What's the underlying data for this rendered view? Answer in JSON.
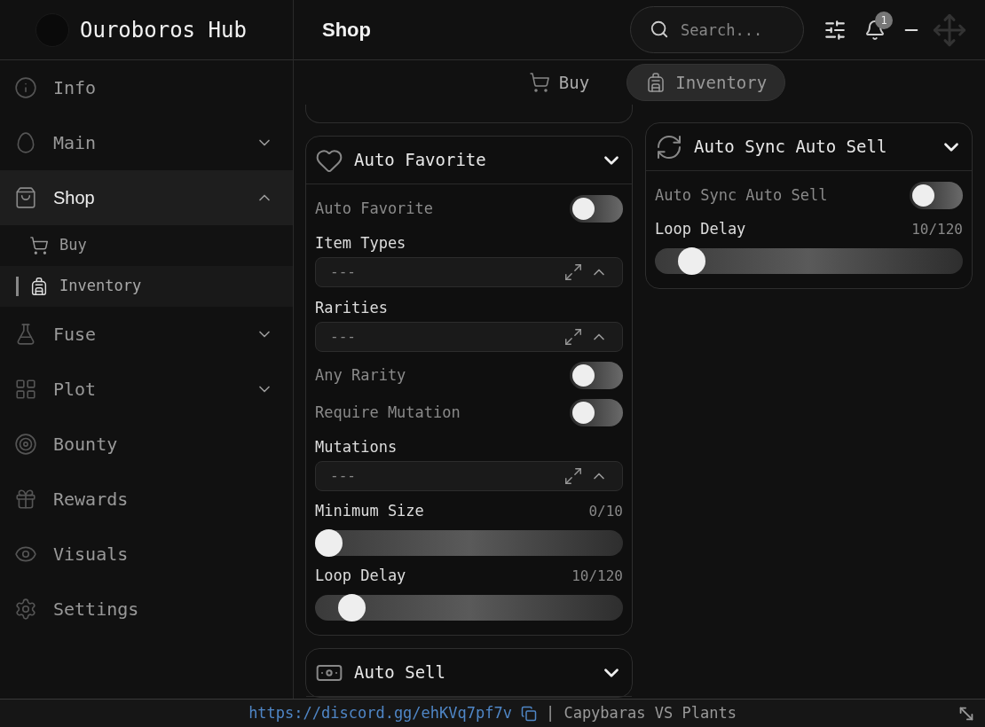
{
  "window": {
    "title": "Ouroboros Hub"
  },
  "sidebar": {
    "items": [
      {
        "label": "Info",
        "kind": "page",
        "selected": false
      },
      {
        "label": "Main",
        "kind": "group",
        "expanded": false,
        "selected": false
      },
      {
        "label": "Shop",
        "kind": "group",
        "expanded": true,
        "selected": true,
        "children": [
          {
            "label": "Buy",
            "selected": false
          },
          {
            "label": "Inventory",
            "selected": true
          }
        ]
      },
      {
        "label": "Fuse",
        "kind": "group",
        "expanded": false,
        "selected": false
      },
      {
        "label": "Plot",
        "kind": "group",
        "expanded": false,
        "selected": false
      },
      {
        "label": "Bounty",
        "kind": "page",
        "selected": false
      },
      {
        "label": "Rewards",
        "kind": "page",
        "selected": false
      },
      {
        "label": "Visuals",
        "kind": "page",
        "selected": false
      },
      {
        "label": "Settings",
        "kind": "page",
        "selected": false
      }
    ]
  },
  "header": {
    "title": "Shop",
    "search": {
      "placeholder": "Search..."
    },
    "notification_count": "1"
  },
  "tabs": [
    {
      "label": "Buy",
      "selected": false
    },
    {
      "label": "Inventory",
      "selected": true
    }
  ],
  "columns": [
    [
      {
        "title": "Auto Favorite",
        "items": [
          {
            "kind": "toggle",
            "label": "Auto Favorite",
            "on": false
          },
          {
            "kind": "dropdown",
            "label": "Item Types",
            "value": "---"
          },
          {
            "kind": "dropdown",
            "label": "Rarities",
            "value": "---"
          },
          {
            "kind": "toggle",
            "label": "Any Rarity",
            "on": false
          },
          {
            "kind": "toggle",
            "label": "Require Mutation",
            "on": false
          },
          {
            "kind": "dropdown",
            "label": "Mutations",
            "value": "---"
          },
          {
            "kind": "slider",
            "label": "Minimum Size",
            "reading": "0/10",
            "level": 0
          },
          {
            "kind": "slider",
            "label": "Loop Delay",
            "reading": "10/120",
            "level": 0.083
          }
        ]
      },
      {
        "title": "Auto Sell"
      }
    ],
    [
      {
        "title": "Auto Sync Auto Sell",
        "items": [
          {
            "kind": "toggle",
            "label": "Auto Sync Auto Sell",
            "on": false
          },
          {
            "kind": "slider",
            "label": "Loop Delay",
            "reading": "10/120",
            "level": 0.083
          }
        ]
      }
    ]
  ],
  "footer": {
    "link": "https://discord.gg/ehKVq7pf7v",
    "text": "| Capybaras VS Plants"
  }
}
